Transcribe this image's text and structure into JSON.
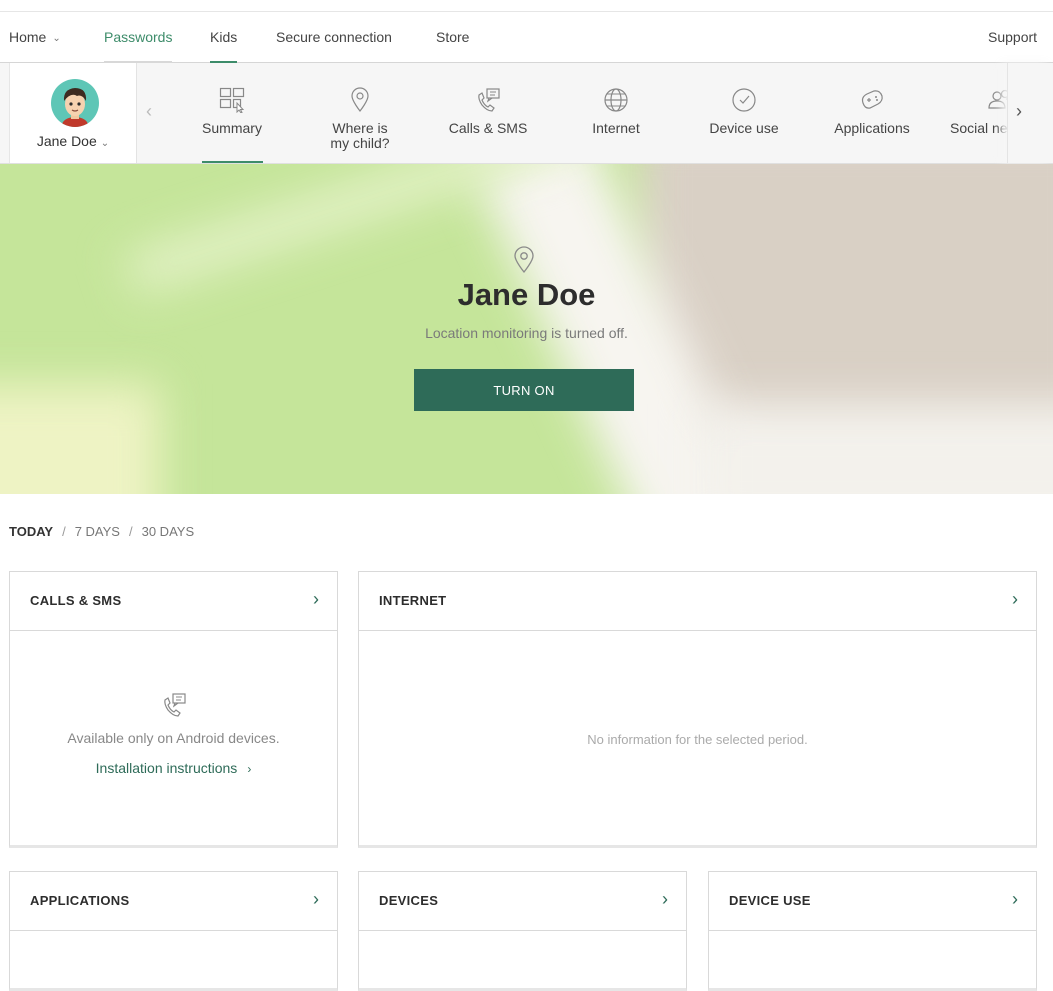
{
  "topnav": {
    "home": "Home",
    "passwords": "Passwords",
    "kids": "Kids",
    "secure_connection": "Secure connection",
    "store": "Store",
    "support": "Support"
  },
  "child": {
    "name": "Jane Doe"
  },
  "tabs": [
    {
      "label": "Summary",
      "icon": "dashboard-icon"
    },
    {
      "label": "Where is my child?",
      "icon": "location-pin-icon"
    },
    {
      "label": "Calls & SMS",
      "icon": "phone-message-icon"
    },
    {
      "label": "Internet",
      "icon": "globe-icon"
    },
    {
      "label": "Device use",
      "icon": "clock-icon"
    },
    {
      "label": "Applications",
      "icon": "gamepad-icon"
    },
    {
      "label": "Social ne",
      "icon": "people-icon"
    }
  ],
  "hero": {
    "name": "Jane Doe",
    "subtitle": "Location monitoring is turned off.",
    "button": "TURN ON"
  },
  "period": {
    "today": "TODAY",
    "seven_days": "7 DAYS",
    "thirty_days": "30 DAYS",
    "separator": "/"
  },
  "cards": {
    "calls_sms": {
      "title": "CALLS & SMS",
      "message": "Available only on Android devices.",
      "link": "Installation instructions"
    },
    "internet": {
      "title": "INTERNET",
      "message": "No information for the selected period."
    },
    "applications": {
      "title": "APPLICATIONS"
    },
    "devices": {
      "title": "DEVICES"
    },
    "device_use": {
      "title": "DEVICE USE"
    }
  },
  "colors": {
    "accent": "#2e6b58",
    "accent_light": "#3d8c6a",
    "map_green": "#c5e59a",
    "map_beige": "#d9d0c5"
  }
}
